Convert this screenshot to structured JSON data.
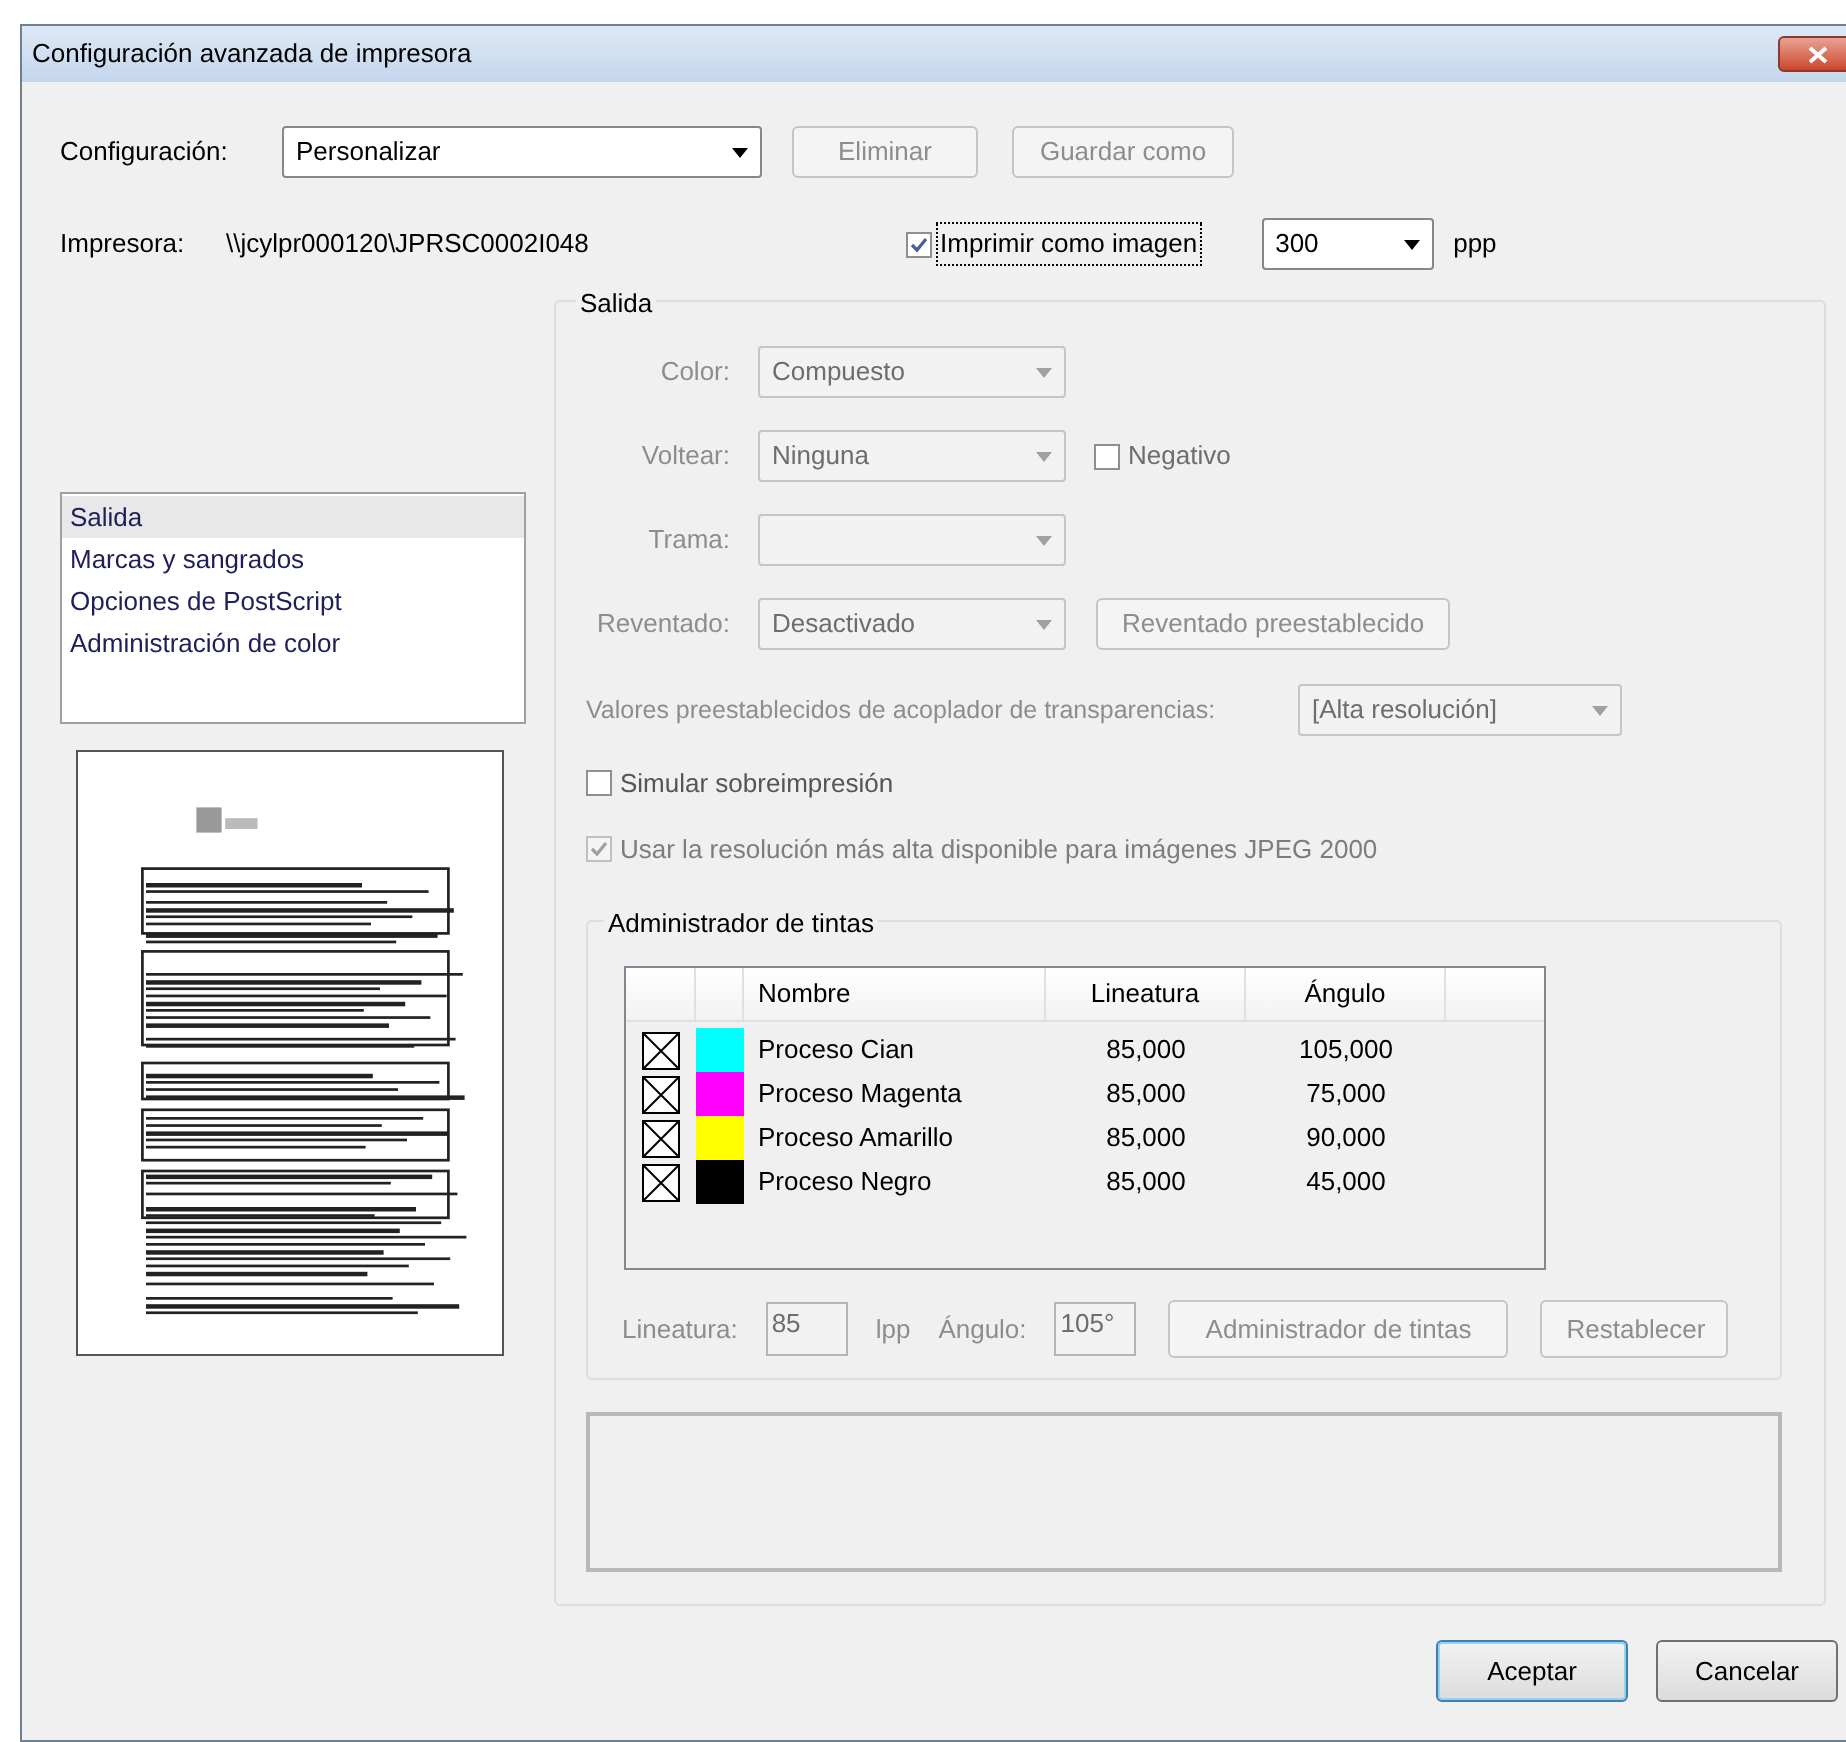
{
  "window": {
    "title": "Configuración avanzada de impresora"
  },
  "configuration": {
    "label": "Configuración:",
    "value": "Personalizar",
    "buttons": [
      {
        "label": "Eliminar",
        "disabled": true
      },
      {
        "label": "Guardar como",
        "disabled": true
      }
    ]
  },
  "printer": {
    "label": "Impresora:",
    "value": "\\\\jcylpr000120\\JPRSC0002I048",
    "print_as_image": {
      "label": "Imprimir como imagen",
      "checked": true
    },
    "resolution": "300",
    "unit": "ppp"
  },
  "sidebar": {
    "items": [
      {
        "label": "Salida",
        "selected": true
      },
      {
        "label": "Marcas y sangrados",
        "selected": false
      },
      {
        "label": "Opciones de PostScript",
        "selected": false
      },
      {
        "label": "Administración de color",
        "selected": false
      }
    ]
  },
  "output": {
    "title": "Salida",
    "fields": [
      {
        "kind": "select",
        "label": "Color:",
        "value": "Compuesto",
        "disabled": true
      },
      {
        "kind": "select",
        "label": "Voltear:",
        "value": "Ninguna",
        "disabled": true,
        "checkbox": {
          "label": "Negativo",
          "checked": false
        }
      },
      {
        "kind": "select",
        "label": "Trama:",
        "disabled": true
      },
      {
        "kind": "select",
        "label": "Reventado:",
        "value": "Desactivado",
        "disabled": true,
        "button": "Reventado preestablecido"
      }
    ],
    "flattener": {
      "label": "Valores preestablecidos de acoplador de transparencias:",
      "value": "[Alta resolución]"
    },
    "checkboxes": [
      {
        "label": "Simular sobreimpresión",
        "checked": false,
        "disabled": false
      },
      {
        "label": "Usar la resolución más alta disponible para imágenes JPEG 2000",
        "checked": true,
        "disabled": true
      }
    ],
    "ink_manager": {
      "title": "Administrador de tintas",
      "columns": [
        "Nombre",
        "Lineatura",
        "Ángulo"
      ],
      "rows": [
        {
          "name": "Proceso Cian",
          "color": "#00ffff",
          "lineature": "85,000",
          "angle": "105,000"
        },
        {
          "name": "Proceso Magenta",
          "color": "#ff00ff",
          "lineature": "85,000",
          "angle": "75,000"
        },
        {
          "name": "Proceso Amarillo",
          "color": "#ffff00",
          "lineature": "85,000",
          "angle": "90,000"
        },
        {
          "name": "Proceso Negro",
          "color": "#000000",
          "lineature": "85,000",
          "angle": "45,000"
        }
      ],
      "lineature_label": "Lineatura:",
      "lineature_value": "85",
      "lineature_unit": "lpp",
      "angle_label": "Ángulo:",
      "angle_value": "105°",
      "buttons": [
        "Administrador de tintas",
        "Restablecer"
      ]
    }
  },
  "buttons": [
    {
      "label": "Aceptar",
      "default": true
    },
    {
      "label": "Cancelar",
      "default": false
    }
  ]
}
